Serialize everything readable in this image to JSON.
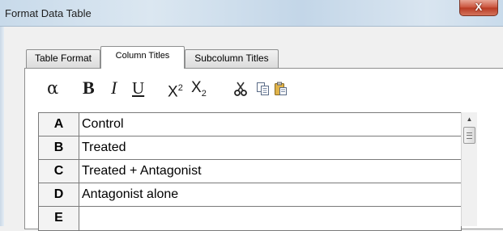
{
  "window": {
    "title": "Format Data Table",
    "close_glyph": "X"
  },
  "tabs": [
    {
      "label": "Table Format",
      "active": false
    },
    {
      "label": "Column Titles",
      "active": true
    },
    {
      "label": "Subcolumn Titles",
      "active": false
    }
  ],
  "toolbar": {
    "alpha": "α",
    "bold": "B",
    "italic": "I",
    "underline": "U",
    "superscript_base": "X",
    "superscript_mark": "2",
    "subscript_base": "X",
    "subscript_mark": "2",
    "icons": [
      "cut-icon",
      "copy-icon",
      "paste-icon"
    ]
  },
  "columns": [
    {
      "id": "A",
      "title": "Control"
    },
    {
      "id": "B",
      "title": "Treated"
    },
    {
      "id": "C",
      "title": "Treated + Antagonist"
    },
    {
      "id": "D",
      "title": "Antagonist alone"
    },
    {
      "id": "E",
      "title": ""
    }
  ],
  "colors": {
    "titlebar": "#c8daea",
    "close_button": "#c9513a",
    "panel_background": "#ffffff",
    "window_background": "#f0f0f0"
  }
}
